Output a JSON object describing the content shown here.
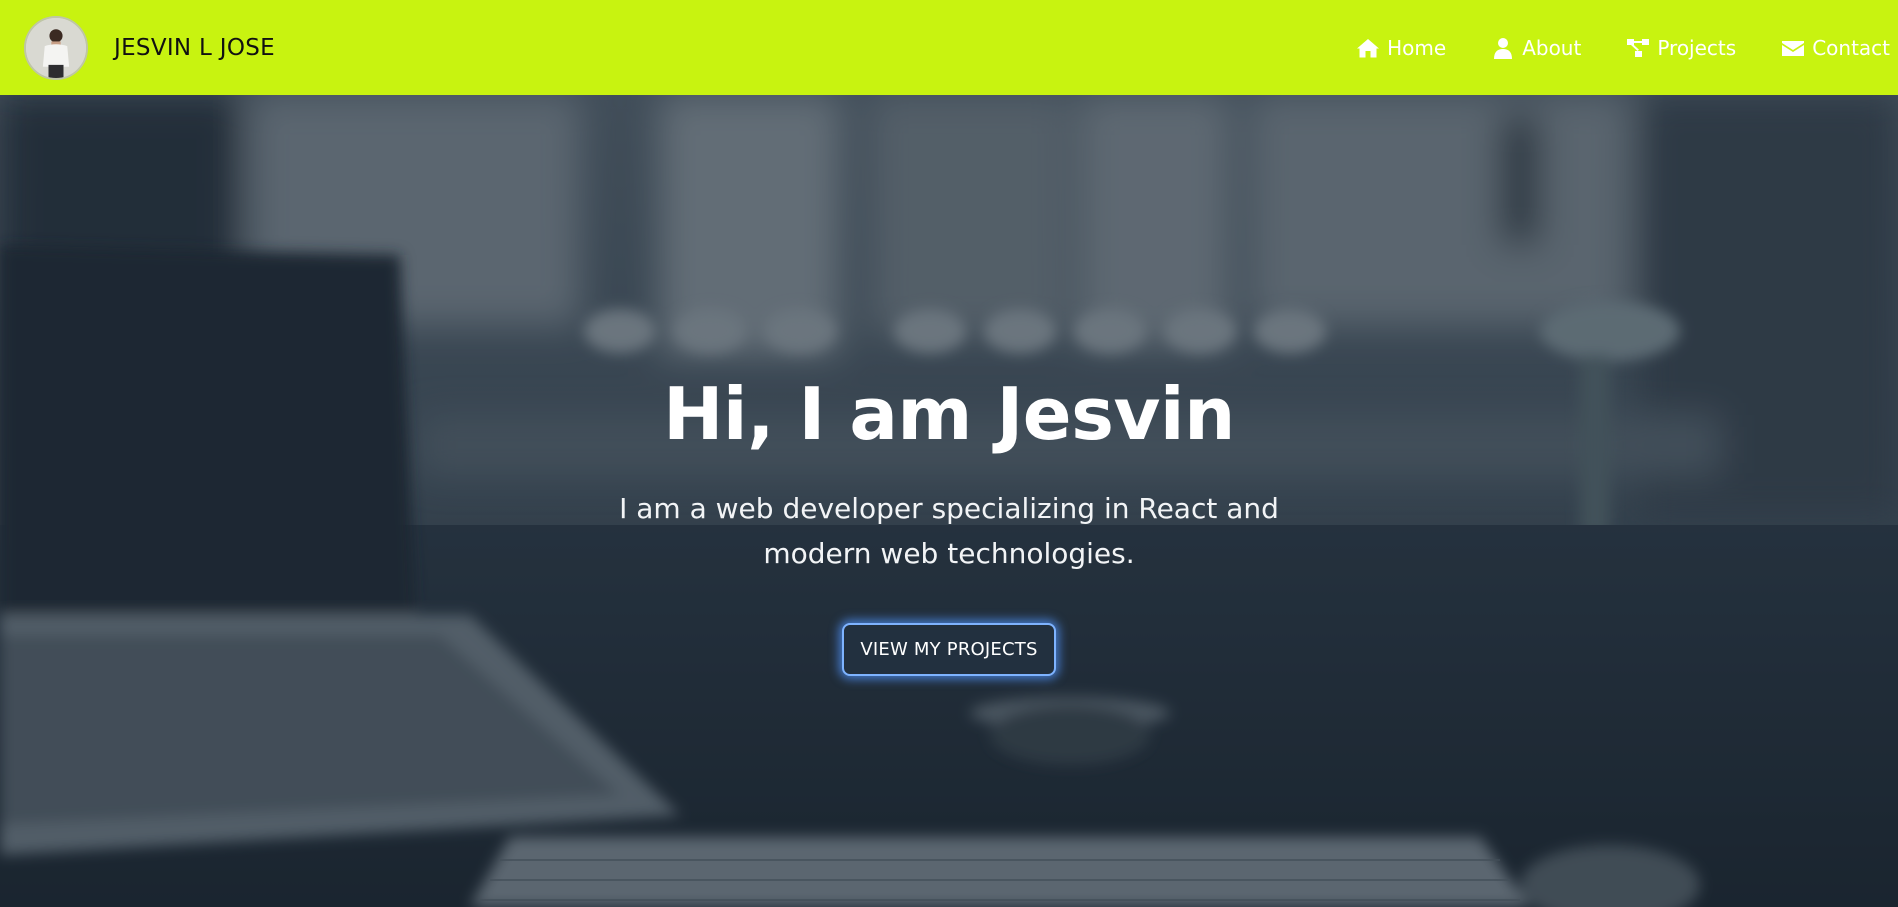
{
  "colors": {
    "header_bg": "#c8f310",
    "hero_overlay": "#1e2a36",
    "button_glow": "#5296ff"
  },
  "header": {
    "brand_name": "JESVIN L JOSE",
    "avatar_icon": "profile-photo",
    "nav": [
      {
        "label": "Home",
        "icon": "home-icon"
      },
      {
        "label": "About",
        "icon": "user-icon"
      },
      {
        "label": "Projects",
        "icon": "sitemap-icon"
      },
      {
        "label": "Contact",
        "icon": "envelope-icon"
      }
    ]
  },
  "hero": {
    "title": "Hi, I am Jesvin",
    "subtitle": "I am a web developer specializing in React and modern web technologies.",
    "button_label": "VIEW MY PROJECTS"
  }
}
